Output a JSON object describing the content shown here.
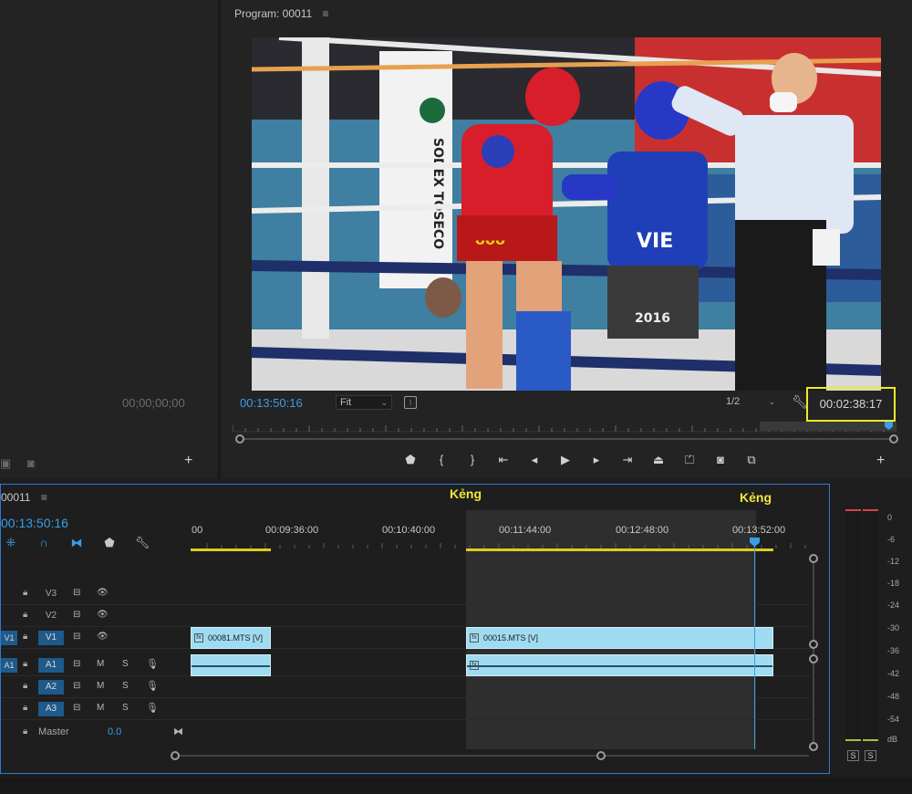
{
  "source": {
    "timecode": "00;00;00;00"
  },
  "program": {
    "title": "Program: 00011",
    "menu_icon": "≡",
    "timecode_left": "00:13:50:16",
    "fit_label": "Fit",
    "resolution_label": "1/2",
    "timecode_right": "00:02:38:17",
    "video_text": {
      "corner_logo": "SODEX TOSECO",
      "fighter_shorts": "VIE",
      "fighter_number": "2016"
    }
  },
  "timeline": {
    "sequence_name": "00011",
    "menu_icon": "≡",
    "timecode": "00:13:50:16",
    "ruler_labels": [
      "00",
      "00:09:36:00",
      "00:10:40:00",
      "00:11:44:00",
      "00:12:48:00",
      "00:13:52:00"
    ],
    "markers": [
      "Kẻng",
      "Kẻng"
    ],
    "tracks": [
      {
        "name": "V3",
        "type": "video"
      },
      {
        "name": "V2",
        "type": "video"
      },
      {
        "name": "V1",
        "type": "video",
        "target": "V1"
      },
      {
        "name": "A1",
        "type": "audio",
        "target": "A1"
      },
      {
        "name": "A2",
        "type": "audio"
      },
      {
        "name": "A3",
        "type": "audio"
      }
    ],
    "audio_buttons": {
      "mute": "M",
      "solo": "S"
    },
    "clips": [
      {
        "name": "00081.MTS [V]",
        "track": "V1"
      },
      {
        "name": "00015.MTS [V]",
        "track": "V1"
      }
    ],
    "master": {
      "label": "Master",
      "value": "0.0"
    }
  },
  "meter": {
    "db_labels": [
      "0",
      "-6",
      "-12",
      "-18",
      "-24",
      "-30",
      "-36",
      "-42",
      "-48",
      "-54",
      "dB"
    ],
    "solo_buttons": [
      "S",
      "S"
    ]
  }
}
